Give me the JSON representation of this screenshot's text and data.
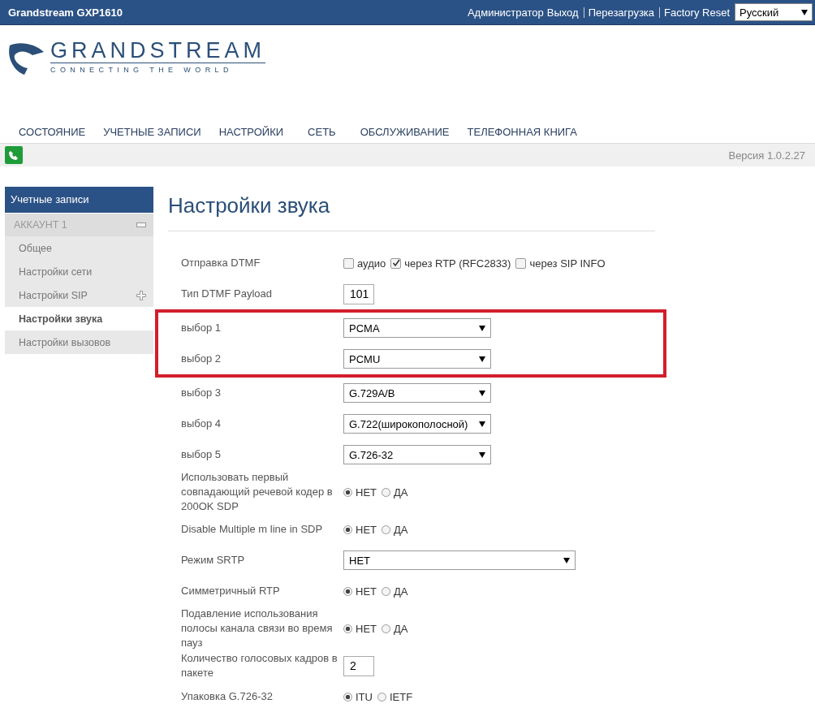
{
  "top_bar": {
    "title": "Grandstream GXP1610",
    "links": [
      {
        "label": "Администратор"
      },
      {
        "label": "Выход"
      },
      {
        "label": "Перезагрузка"
      },
      {
        "label": "Factory Reset"
      }
    ],
    "language": "Русский"
  },
  "logo": {
    "name": "GRANDSTREAM",
    "tagline": "CONNECTING THE WORLD"
  },
  "nav": [
    "СОСТОЯНИЕ",
    "УЧЕТНЫЕ ЗАПИСИ",
    "НАСТРОЙКИ",
    "СЕТЬ",
    "ОБСЛУЖИВАНИЕ",
    "ТЕЛЕФОННАЯ КНИГА"
  ],
  "version": "Версия 1.0.2.27",
  "sidebar": {
    "title": "Учетные записи",
    "items": [
      {
        "kind": "group",
        "label": "АККАУНТ 1",
        "expanded": true,
        "selected": false
      },
      {
        "kind": "item",
        "label": "Общее",
        "selected": false
      },
      {
        "kind": "item",
        "label": "Настройки сети",
        "selected": false
      },
      {
        "kind": "item",
        "label": "Настройки SIP",
        "expanded": false,
        "selected": false
      },
      {
        "kind": "item",
        "label": "Настройки звука",
        "selected": true
      },
      {
        "kind": "item",
        "label": "Настройки вызовов",
        "selected": false
      }
    ]
  },
  "page_title": "Настройки звука",
  "rows": [
    {
      "kind": "checks",
      "label": "Отправка DTMF",
      "highlighted": false,
      "options": [
        {
          "label": "аудио",
          "checked": false
        },
        {
          "label": "через RTP (RFC2833)",
          "checked": true
        },
        {
          "label": "через SIP INFO",
          "checked": false
        }
      ]
    },
    {
      "kind": "text",
      "label": "Тип DTMF Payload",
      "highlighted": false,
      "value": "101"
    },
    {
      "kind": "select",
      "label": "выбор 1",
      "highlighted": true,
      "value": "PCMA"
    },
    {
      "kind": "select",
      "label": "выбор 2",
      "highlighted": true,
      "value": "PCMU"
    },
    {
      "kind": "select",
      "label": "выбор 3",
      "highlighted": false,
      "value": "G.729A/B"
    },
    {
      "kind": "select",
      "label": "выбор 4",
      "highlighted": false,
      "value": "G.722(широкополосной)"
    },
    {
      "kind": "select",
      "label": "выбор 5",
      "highlighted": false,
      "value": "G.726-32"
    },
    {
      "kind": "radio",
      "label": "Использовать первый совпадающий речевой кодер в 200OK SDP",
      "highlighted": false,
      "options": [
        {
          "label": "НЕТ",
          "selected": true
        },
        {
          "label": "ДА",
          "selected": false
        }
      ]
    },
    {
      "kind": "radio",
      "label": "Disable Multiple m line in SDP",
      "highlighted": false,
      "options": [
        {
          "label": "НЕТ",
          "selected": true
        },
        {
          "label": "ДА",
          "selected": false
        }
      ]
    },
    {
      "kind": "wideselect",
      "label": "Режим SRTP",
      "highlighted": false,
      "value": "НЕТ"
    },
    {
      "kind": "radio",
      "label": "Симметричный RTP",
      "highlighted": false,
      "options": [
        {
          "label": "НЕТ",
          "selected": true
        },
        {
          "label": "ДА",
          "selected": false
        }
      ]
    },
    {
      "kind": "radio",
      "label": "Подавление использования полосы канала связи во время пауз",
      "highlighted": false,
      "options": [
        {
          "label": "НЕТ",
          "selected": true
        },
        {
          "label": "ДА",
          "selected": false
        }
      ]
    },
    {
      "kind": "text",
      "label": "Количество голосовых кадров в пакете",
      "highlighted": false,
      "value": "2"
    },
    {
      "kind": "radio",
      "label": "Упаковка G.726-32",
      "highlighted": false,
      "options": [
        {
          "label": "ITU",
          "selected": true
        },
        {
          "label": "IETF",
          "selected": false
        }
      ]
    }
  ]
}
